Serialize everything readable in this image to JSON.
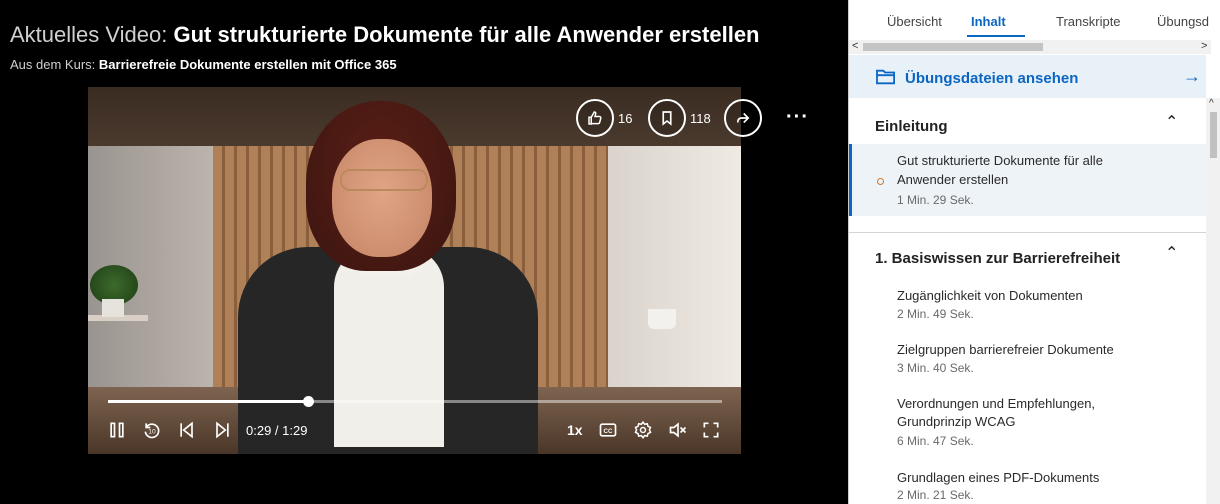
{
  "player": {
    "title_prefix": "Aktuelles Video:",
    "title": "Gut strukturierte Dokumente für alle Anwender erstellen",
    "course_prefix": "Aus dem Kurs:",
    "course": "Barrierefreie Dokumente erstellen mit Office 365",
    "likes": "16",
    "saves": "118",
    "more_label": "···",
    "time": "0:29 / 1:29",
    "progress": 0.326,
    "speed": "1x",
    "icons": {
      "like": "like-icon",
      "save": "bookmark-icon",
      "share": "share-icon",
      "pause": "pause-icon",
      "rewind10": "rewind-10-icon",
      "prev": "previous-icon",
      "next": "next-icon",
      "captions": "captions-icon",
      "settings": "settings-icon",
      "mute": "mute-icon",
      "fullscreen": "fullscreen-icon"
    }
  },
  "sidebar": {
    "tabs": [
      {
        "label": "Übersicht"
      },
      {
        "label": "Inhalt"
      },
      {
        "label": "Transkripte"
      },
      {
        "label": "Übungsd"
      }
    ],
    "active_tab": "Inhalt",
    "exercise_files": "Übungsdateien ansehen",
    "sections": [
      {
        "title": "Einleitung",
        "items": [
          {
            "title_line1": "Gut strukturierte Dokumente für alle",
            "title_line2": "Anwender erstellen",
            "duration": "1 Min. 29 Sek."
          }
        ]
      },
      {
        "title": "1. Basiswissen zur Barrierefreiheit",
        "items": [
          {
            "title_line1": "Zugänglichkeit von Dokumenten",
            "duration": "2 Min. 49 Sek."
          },
          {
            "title_line1": "Zielgruppen barrierefreier Dokumente",
            "duration": "3 Min. 40 Sek."
          },
          {
            "title_line1": "Verordnungen und Empfehlungen,",
            "title_line2": "Grundprinzip WCAG",
            "duration": "6 Min. 47 Sek."
          },
          {
            "title_line1": "Grundlagen eines PDF-Dokuments",
            "duration": "2 Min. 21 Sek."
          }
        ]
      }
    ]
  },
  "colors": {
    "accent": "#0a66c2",
    "current_dot": "#d0792d"
  }
}
